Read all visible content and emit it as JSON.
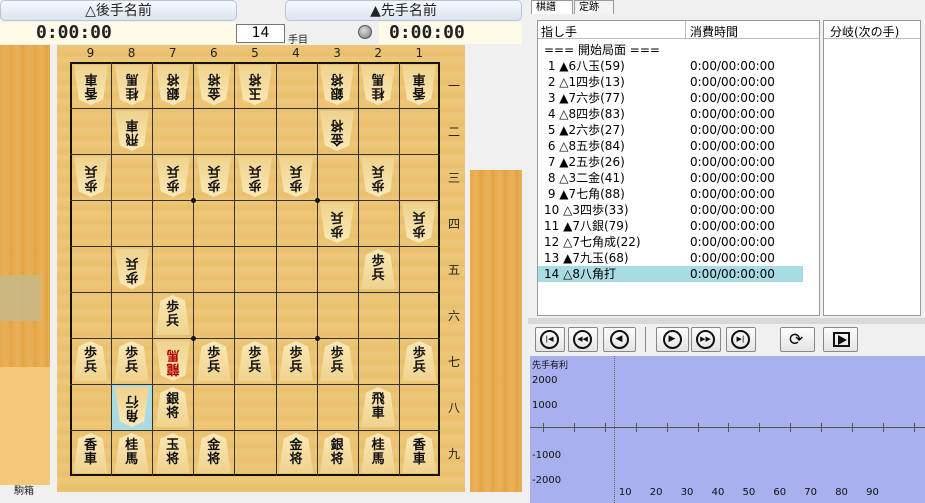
{
  "players": {
    "gote_name": "△後手名前",
    "sente_name": "▲先手名前",
    "gote_time": "0:00:00",
    "sente_time": "0:00:00"
  },
  "move_counter": {
    "value": "14",
    "label": "手目"
  },
  "board": {
    "col_labels": [
      "9",
      "8",
      "7",
      "6",
      "5",
      "4",
      "3",
      "2",
      "1"
    ],
    "row_labels": [
      "一",
      "二",
      "三",
      "四",
      "五",
      "六",
      "七",
      "八",
      "九"
    ],
    "pieces": [
      {
        "c": 9,
        "r": 1,
        "t": [
          "香",
          "車"
        ],
        "o": "g"
      },
      {
        "c": 8,
        "r": 1,
        "t": [
          "桂",
          "馬"
        ],
        "o": "g"
      },
      {
        "c": 7,
        "r": 1,
        "t": [
          "銀",
          "将"
        ],
        "o": "g"
      },
      {
        "c": 6,
        "r": 1,
        "t": [
          "金",
          "将"
        ],
        "o": "g"
      },
      {
        "c": 5,
        "r": 1,
        "t": [
          "玉",
          "将"
        ],
        "o": "g"
      },
      {
        "c": 3,
        "r": 1,
        "t": [
          "銀",
          "将"
        ],
        "o": "g"
      },
      {
        "c": 2,
        "r": 1,
        "t": [
          "桂",
          "馬"
        ],
        "o": "g"
      },
      {
        "c": 1,
        "r": 1,
        "t": [
          "香",
          "車"
        ],
        "o": "g"
      },
      {
        "c": 8,
        "r": 2,
        "t": [
          "飛",
          "車"
        ],
        "o": "g"
      },
      {
        "c": 3,
        "r": 2,
        "t": [
          "金",
          "将"
        ],
        "o": "g"
      },
      {
        "c": 9,
        "r": 3,
        "t": [
          "歩",
          "兵"
        ],
        "o": "g"
      },
      {
        "c": 7,
        "r": 3,
        "t": [
          "歩",
          "兵"
        ],
        "o": "g"
      },
      {
        "c": 6,
        "r": 3,
        "t": [
          "歩",
          "兵"
        ],
        "o": "g"
      },
      {
        "c": 5,
        "r": 3,
        "t": [
          "歩",
          "兵"
        ],
        "o": "g"
      },
      {
        "c": 4,
        "r": 3,
        "t": [
          "歩",
          "兵"
        ],
        "o": "g"
      },
      {
        "c": 2,
        "r": 3,
        "t": [
          "歩",
          "兵"
        ],
        "o": "g"
      },
      {
        "c": 3,
        "r": 4,
        "t": [
          "歩",
          "兵"
        ],
        "o": "g"
      },
      {
        "c": 1,
        "r": 4,
        "t": [
          "歩",
          "兵"
        ],
        "o": "g"
      },
      {
        "c": 8,
        "r": 5,
        "t": [
          "歩",
          "兵"
        ],
        "o": "g"
      },
      {
        "c": 2,
        "r": 5,
        "t": [
          "歩",
          "兵"
        ],
        "o": "s"
      },
      {
        "c": 7,
        "r": 6,
        "t": [
          "歩",
          "兵"
        ],
        "o": "s"
      },
      {
        "c": 9,
        "r": 7,
        "t": [
          "歩",
          "兵"
        ],
        "o": "s"
      },
      {
        "c": 8,
        "r": 7,
        "t": [
          "歩",
          "兵"
        ],
        "o": "s"
      },
      {
        "c": 7,
        "r": 7,
        "t": [
          "龍",
          "馬"
        ],
        "o": "g",
        "red": true
      },
      {
        "c": 6,
        "r": 7,
        "t": [
          "歩",
          "兵"
        ],
        "o": "s"
      },
      {
        "c": 5,
        "r": 7,
        "t": [
          "歩",
          "兵"
        ],
        "o": "s"
      },
      {
        "c": 4,
        "r": 7,
        "t": [
          "歩",
          "兵"
        ],
        "o": "s"
      },
      {
        "c": 3,
        "r": 7,
        "t": [
          "歩",
          "兵"
        ],
        "o": "s"
      },
      {
        "c": 1,
        "r": 7,
        "t": [
          "歩",
          "兵"
        ],
        "o": "s"
      },
      {
        "c": 8,
        "r": 8,
        "t": [
          "角",
          "行"
        ],
        "o": "g"
      },
      {
        "c": 7,
        "r": 8,
        "t": [
          "銀",
          "将"
        ],
        "o": "s"
      },
      {
        "c": 2,
        "r": 8,
        "t": [
          "飛",
          "車"
        ],
        "o": "s"
      },
      {
        "c": 9,
        "r": 9,
        "t": [
          "香",
          "車"
        ],
        "o": "s"
      },
      {
        "c": 8,
        "r": 9,
        "t": [
          "桂",
          "馬"
        ],
        "o": "s"
      },
      {
        "c": 7,
        "r": 9,
        "t": [
          "玉",
          "将"
        ],
        "o": "s"
      },
      {
        "c": 6,
        "r": 9,
        "t": [
          "金",
          "将"
        ],
        "o": "s"
      },
      {
        "c": 4,
        "r": 9,
        "t": [
          "金",
          "将"
        ],
        "o": "s"
      },
      {
        "c": 3,
        "r": 9,
        "t": [
          "銀",
          "将"
        ],
        "o": "s"
      },
      {
        "c": 2,
        "r": 9,
        "t": [
          "桂",
          "馬"
        ],
        "o": "s"
      },
      {
        "c": 1,
        "r": 9,
        "t": [
          "香",
          "車"
        ],
        "o": "s"
      }
    ],
    "highlight": {
      "c": 8,
      "r": 8
    },
    "piece_box_label": "駒箱"
  },
  "tabs": [
    "棋譜",
    "定跡"
  ],
  "kifu": {
    "header_move": "指し手",
    "header_time": "消費時間",
    "rows": [
      {
        "mv": "=== 開始局面 ===",
        "tm": ""
      },
      {
        "mv": " 1 ▲6八玉(59)",
        "tm": "0:00/00:00:00"
      },
      {
        "mv": " 2 △1四歩(13)",
        "tm": "0:00/00:00:00"
      },
      {
        "mv": " 3 ▲7六歩(77)",
        "tm": "0:00/00:00:00"
      },
      {
        "mv": " 4 △8四歩(83)",
        "tm": "0:00/00:00:00"
      },
      {
        "mv": " 5 ▲2六歩(27)",
        "tm": "0:00/00:00:00"
      },
      {
        "mv": " 6 △8五歩(84)",
        "tm": "0:00/00:00:00"
      },
      {
        "mv": " 7 ▲2五歩(26)",
        "tm": "0:00/00:00:00"
      },
      {
        "mv": " 8 △3二金(41)",
        "tm": "0:00/00:00:00"
      },
      {
        "mv": " 9 ▲7七角(88)",
        "tm": "0:00/00:00:00"
      },
      {
        "mv": "10 △3四歩(33)",
        "tm": "0:00/00:00:00"
      },
      {
        "mv": "11 ▲7八銀(79)",
        "tm": "0:00/00:00:00"
      },
      {
        "mv": "12 △7七角成(22)",
        "tm": "0:00/00:00:00"
      },
      {
        "mv": "13 ▲7九玉(68)",
        "tm": "0:00/00:00:00"
      },
      {
        "mv": "14 △8八角打",
        "tm": "0:00/00:00:00"
      }
    ],
    "selected_index": 14
  },
  "branch": {
    "header": "分岐(次の手)"
  },
  "nav_buttons": [
    {
      "name": "first-move-button",
      "glyph": "|◀"
    },
    {
      "name": "prev10-button",
      "glyph": "◀◀"
    },
    {
      "name": "prev-button",
      "glyph": "◀"
    },
    {
      "name": "next-button",
      "glyph": "▶"
    },
    {
      "name": "next10-button",
      "glyph": "▶▶"
    },
    {
      "name": "last-move-button",
      "glyph": "▶|"
    }
  ],
  "graph": {
    "title": "先手有利",
    "y_labels": [
      "2000",
      "1000",
      "-1000",
      "-2000"
    ],
    "x_labels": [
      "10",
      "20",
      "30",
      "40",
      "50",
      "60",
      "70",
      "80",
      "90"
    ],
    "current_move": 14
  }
}
